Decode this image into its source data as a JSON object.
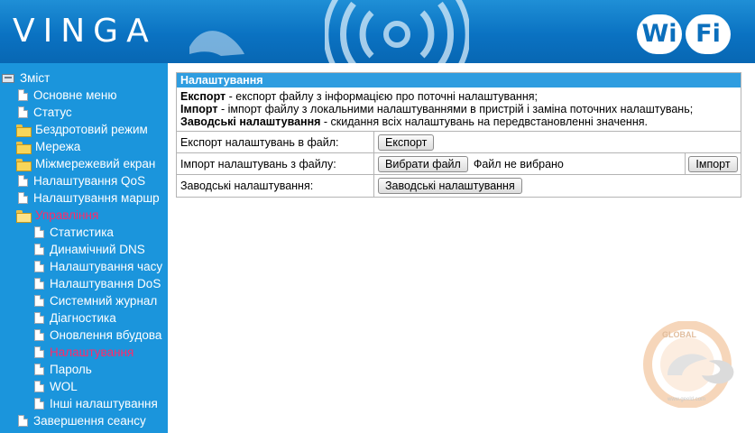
{
  "header": {
    "brand": "VINGA",
    "logo": {
      "left": "Wi",
      "right": "Fi"
    }
  },
  "sidebar": {
    "items": [
      {
        "label": "Зміст",
        "icon": "root-icon",
        "active": false
      },
      {
        "label": "Основне меню",
        "icon": "document-icon",
        "active": false
      },
      {
        "label": "Статус",
        "icon": "document-icon",
        "active": false
      },
      {
        "label": "Бездротовий режим",
        "icon": "folder-icon",
        "active": false
      },
      {
        "label": "Мережа",
        "icon": "folder-icon",
        "active": false
      },
      {
        "label": "Міжмережевий екран",
        "icon": "folder-icon",
        "active": false
      },
      {
        "label": "Налаштування QoS",
        "icon": "document-icon",
        "active": false
      },
      {
        "label": "Налаштування маршр",
        "icon": "document-icon",
        "active": false
      },
      {
        "label": "Управління",
        "icon": "folder-open-icon",
        "active": true
      },
      {
        "label": "Статистика",
        "icon": "document-icon",
        "active": false
      },
      {
        "label": "Динамічний DNS",
        "icon": "document-icon",
        "active": false
      },
      {
        "label": "Налаштування часу",
        "icon": "document-icon",
        "active": false
      },
      {
        "label": "Налаштування DoS",
        "icon": "document-icon",
        "active": false
      },
      {
        "label": "Системний журнал",
        "icon": "document-icon",
        "active": false
      },
      {
        "label": "Діагностика",
        "icon": "document-icon",
        "active": false
      },
      {
        "label": "Оновлення вбудова",
        "icon": "document-icon",
        "active": false
      },
      {
        "label": "Налаштування",
        "icon": "document-icon",
        "active": true
      },
      {
        "label": "Пароль",
        "icon": "document-icon",
        "active": false
      },
      {
        "label": "WOL",
        "icon": "document-icon",
        "active": false
      },
      {
        "label": "Інші налаштування",
        "icon": "document-icon",
        "active": false
      },
      {
        "label": "Завершення сеансу",
        "icon": "document-icon",
        "active": false
      }
    ]
  },
  "panel": {
    "title": "Налаштування",
    "desc": [
      {
        "term": "Експорт",
        "text": " - експорт файлу з інформацією про поточні налаштування;"
      },
      {
        "term": "Імпорт",
        "text": " - імпорт файлу з локальними налаштуваннями в пристрій і заміна поточних налаштувань;"
      },
      {
        "term": "Заводські налаштування",
        "text": " - скидання всіх налаштувань на передвстановленні значення."
      }
    ],
    "export": {
      "label": "Експорт налаштувань в файл:",
      "button": "Експорт"
    },
    "import": {
      "label": "Імпорт налаштувань з файлу:",
      "choose_button": "Вибрати файл",
      "file_status": "Файл не вибрано",
      "button": "Імпорт"
    },
    "factory": {
      "label": "Заводські налаштування:",
      "button": "Заводські налаштування"
    }
  },
  "watermark": {
    "text": "GLOBAL",
    "sub": "www.geeld.com"
  },
  "colors": {
    "header": "#0a72c2",
    "sidebar": "#1b95dc",
    "panel_title": "#2f9de0",
    "active_link": "#ff2a6a"
  }
}
